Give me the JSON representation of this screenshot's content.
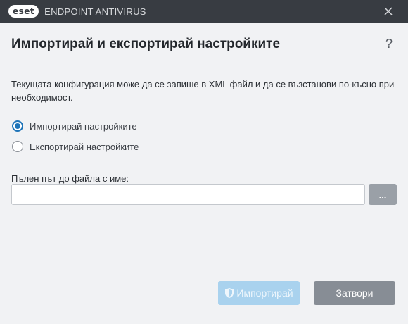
{
  "titlebar": {
    "logo_text": "eset",
    "app_name": "ENDPOINT ANTIVIRUS"
  },
  "dialog": {
    "title": "Импортирай и експортирай настройките",
    "help_glyph": "?",
    "description": "Текущата конфигурация може да се запише в XML файл и да се възстанови по-късно при необходимост.",
    "options": [
      {
        "label": "Импортирай настройките",
        "selected": true
      },
      {
        "label": "Експортирай настройките",
        "selected": false
      }
    ],
    "path_label": "Пълен път до файла с име:",
    "path_value": "",
    "browse_label": "...",
    "import_button": "Импортирай",
    "close_button": "Затвори"
  },
  "colors": {
    "titlebar": "#383c42",
    "background": "#f1f2f4",
    "accent": "#1e74b8",
    "import_disabled": "#a9d2ee",
    "close_button": "#878d95"
  },
  "icons": [
    "close-icon",
    "help-icon",
    "shield-icon"
  ]
}
